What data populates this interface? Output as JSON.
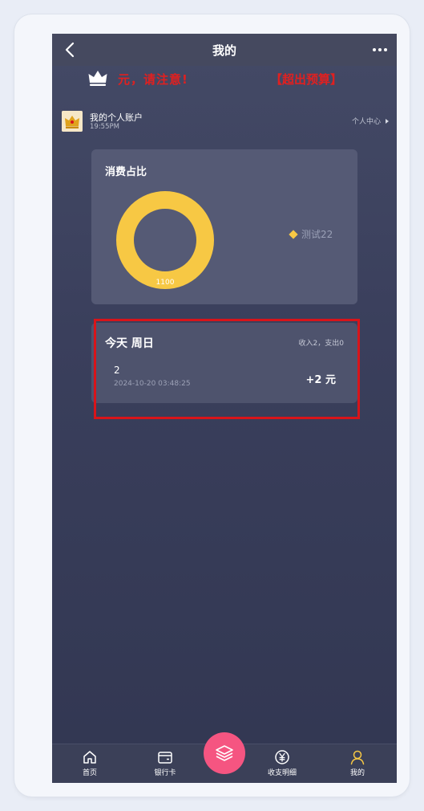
{
  "navbar": {
    "title": "我的",
    "back_icon": "chevron-left-icon",
    "more_icon": "more-dots-icon"
  },
  "notice": {
    "text": "元，请注意!",
    "tag": "【超出预算】",
    "color": "#e02020"
  },
  "account": {
    "name": "我的个人账户",
    "time": "19:55PM",
    "link": "个人中心"
  },
  "chart_card": {
    "title": "消费占比"
  },
  "chart_data": {
    "type": "pie",
    "title": "消费占比",
    "categories": [
      "测试22"
    ],
    "values": [
      1100
    ],
    "data_labels": [
      "1100"
    ],
    "colors": [
      "#f7c844"
    ],
    "legend": "right"
  },
  "today": {
    "title": "今天 周日",
    "summary": "收入2，支出0",
    "record": {
      "name": "2",
      "time": "2024-10-20 03:48:25",
      "amount": "+2 元"
    }
  },
  "tabbar": {
    "items": [
      {
        "label": "首页",
        "icon": "home-icon"
      },
      {
        "label": "银行卡",
        "icon": "wallet-icon"
      },
      {
        "label": "收支明细",
        "icon": "yen-icon"
      },
      {
        "label": "我的",
        "icon": "user-icon",
        "active": true
      }
    ],
    "fab_icon": "layers-icon",
    "active_color": "#f7c844",
    "fab_color": "#f55581"
  }
}
